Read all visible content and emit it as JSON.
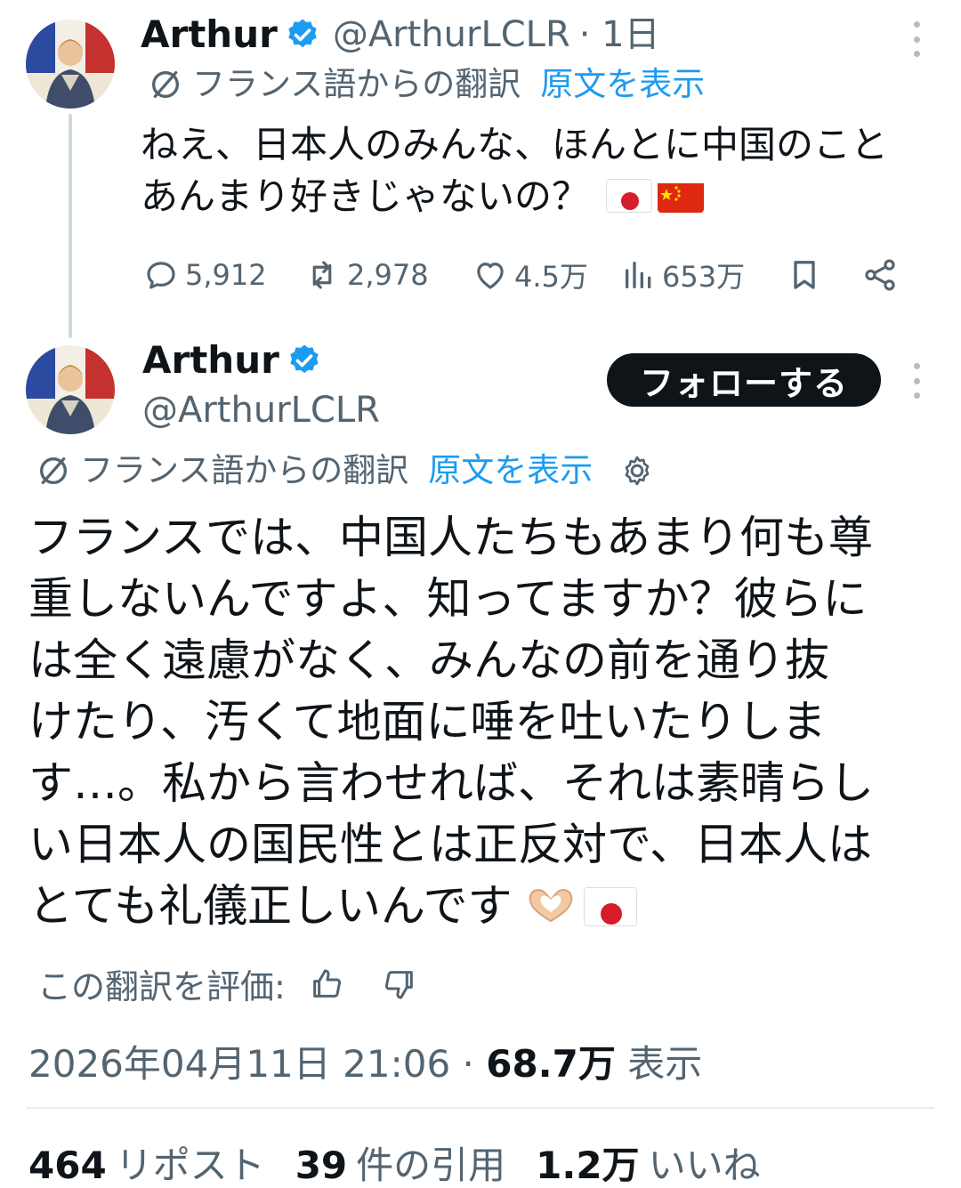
{
  "reply_tweet": {
    "author_name": "Arthur",
    "author_handle": "@ArthurLCLR",
    "time": "· 1日",
    "translation_source": "フランス語からの翻訳",
    "show_original": "原文を表示",
    "text": "ねえ、日本人のみんな、ほんとに中国のことあんまり好きじゃないの？",
    "flags": [
      "japan-flag-emoji",
      "china-flag-emoji"
    ],
    "replies": "5,912",
    "reposts": "2,978",
    "likes": "4.5万",
    "views": "653万"
  },
  "main_tweet": {
    "author_name": "Arthur",
    "author_handle": "@ArthurLCLR",
    "follow_label": "フォローする",
    "translation_source": "フランス語からの翻訳",
    "show_original": "原文を表示",
    "text_lines": [
      "フランスでは、中国人たちもあまり何も尊",
      "重しないんですよ、知ってますか？彼らに",
      "は全く遠慮がなく、みんなの前を通り抜",
      "けたり、汚くて地面に唾を吐いたりしま",
      "す…。私から言わせれば、それは素晴らし",
      "い日本人の国民性とは正反対で、日本人は",
      "とても礼儀正しいんです"
    ],
    "trailing_emoji": [
      "heart-hands-emoji",
      "japan-flag-emoji"
    ],
    "rate_label": "この翻訳を評価:",
    "datetime": "2026年04月11日 21:06 ·",
    "view_count": "68.7万",
    "view_label": "表示",
    "repost_count": "464",
    "repost_label": "リポスト",
    "quote_count": "39",
    "quote_label": "件の引用",
    "like_count": "1.2万",
    "like_label": "いいね"
  },
  "colors": {
    "text": "#0f1419",
    "muted": "#536471",
    "link": "#1d9bf0",
    "verified": "#1d9bf0",
    "divider": "#e6ecf0",
    "button": "#0f1419"
  }
}
